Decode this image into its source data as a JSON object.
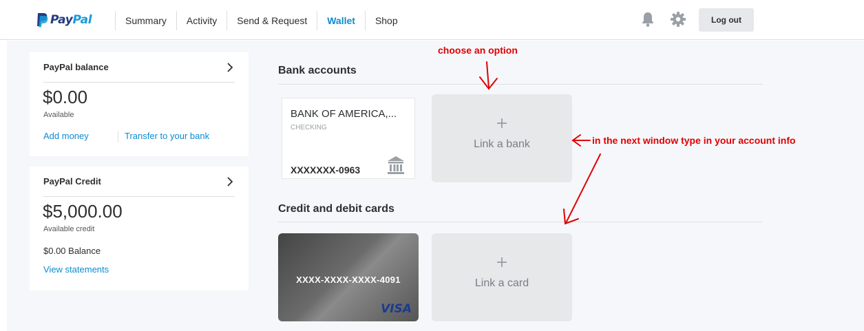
{
  "header": {
    "logo_pay": "Pay",
    "logo_pal": "Pal",
    "nav": [
      {
        "label": "Summary"
      },
      {
        "label": "Activity"
      },
      {
        "label": "Send & Request"
      },
      {
        "label": "Wallet"
      },
      {
        "label": "Shop"
      }
    ],
    "active_tab": "Wallet",
    "logout_label": "Log out",
    "icons": [
      "bell-icon",
      "gear-icon"
    ]
  },
  "balance_panel": {
    "title": "PayPal balance",
    "amount": "$0.00",
    "amount_caption": "Available",
    "add_money": "Add money",
    "transfer": "Transfer to your bank"
  },
  "credit_panel": {
    "title": "PayPal Credit",
    "amount": "$5,000.00",
    "amount_caption": "Available credit",
    "balance": "$0.00 Balance",
    "view_statements": "View statements"
  },
  "bank_section": {
    "title": "Bank accounts",
    "bank": {
      "name": "BANK OF AMERICA,...",
      "type": "CHECKING",
      "number": "XXXXXXX-0963",
      "icon": "bank-icon"
    },
    "link_label": "Link a bank",
    "link_icon": "+"
  },
  "card_section": {
    "title": "Credit and debit cards",
    "card": {
      "number": "XXXX-XXXX-XXXX-4091",
      "brand": "VISA"
    },
    "link_label": "Link a card",
    "link_icon": "+"
  },
  "annotations": {
    "choose": "choose an option",
    "next_window": "in the next window type in your account info"
  },
  "colors": {
    "accent": "#0c8bd1",
    "annotation": "#e00000",
    "paypal_dark": "#253b80",
    "paypal_light": "#179bd7"
  }
}
